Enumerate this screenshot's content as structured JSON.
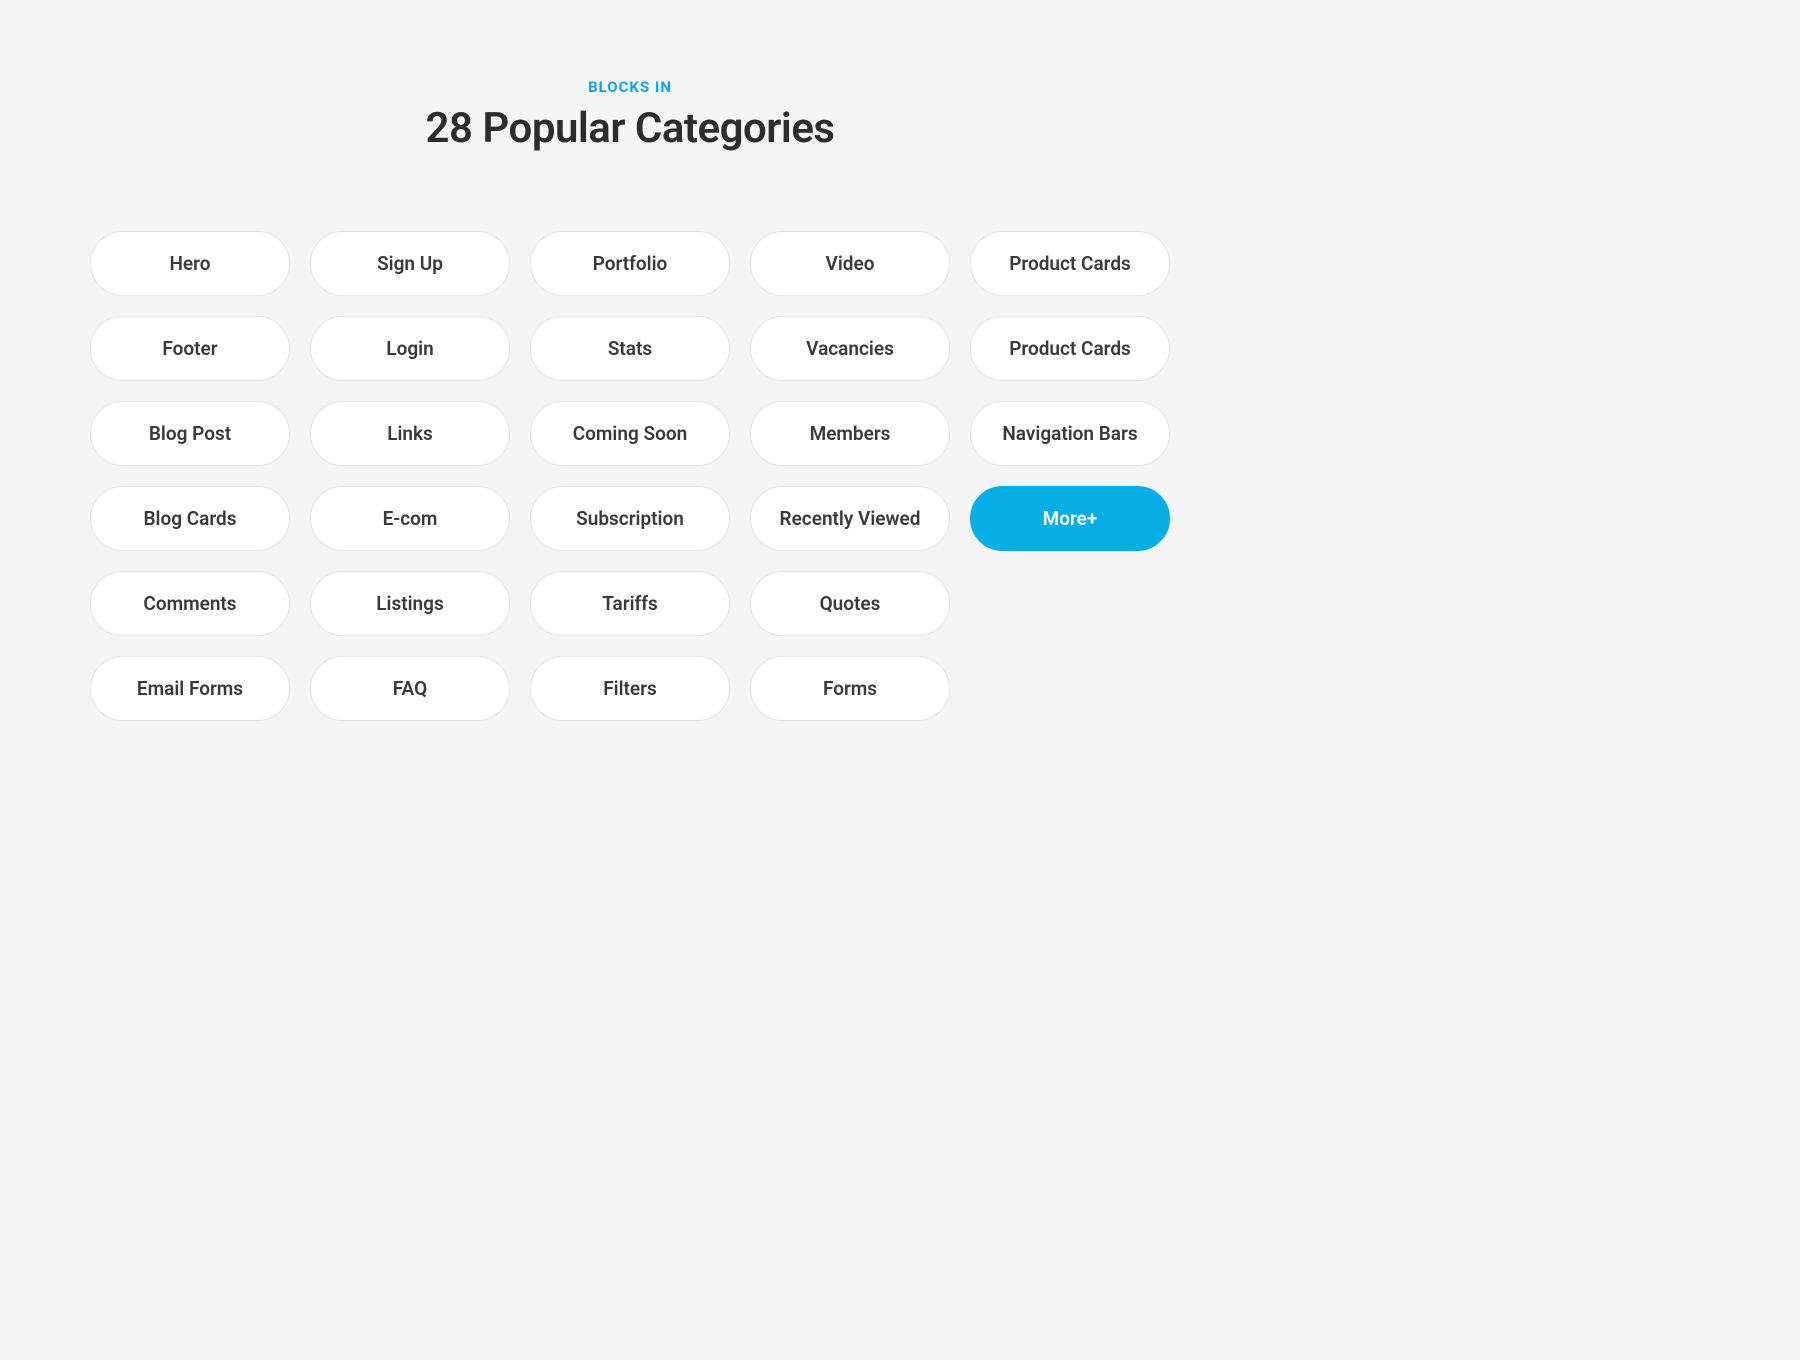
{
  "header": {
    "eyebrow": "BLOCKS IN",
    "title": "28 Popular Categories"
  },
  "categories": {
    "row1": [
      "Hero",
      "Sign Up",
      "Portfolio",
      "Video",
      "Product Cards"
    ],
    "row2": [
      "Footer",
      "Login",
      "Stats",
      "Vacancies",
      "Product Cards"
    ],
    "row3": [
      "Blog Post",
      "Links",
      "Coming Soon",
      "Members",
      "Navigation Bars"
    ],
    "row4": [
      "Blog Cards",
      "E-com",
      "Subscription",
      "Recently Viewed",
      "More+"
    ],
    "row5": [
      "Comments",
      "Listings",
      "Tariffs",
      "Quotes"
    ],
    "row6": [
      "Email Forms",
      "FAQ",
      "Filters",
      "Forms"
    ]
  },
  "accent_index": {
    "row": 4,
    "col": 5
  }
}
